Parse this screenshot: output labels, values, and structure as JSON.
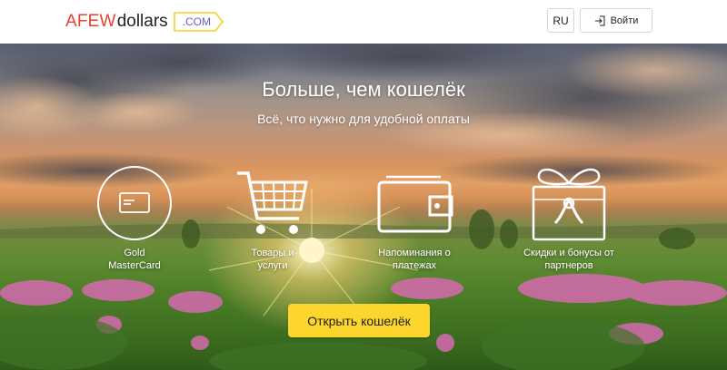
{
  "header": {
    "logo": {
      "part1": "AFEW",
      "part2": "dollars",
      "tld": ".COM"
    },
    "lang_label": "RU",
    "login_label": "Войти"
  },
  "hero": {
    "title": "Больше, чем кошелёк",
    "subtitle": "Всё, что нужно для удобной оплаты",
    "features": [
      {
        "icon": "card-icon",
        "label_line1": "Gold",
        "label_line2": "MasterCard"
      },
      {
        "icon": "shopping-cart-icon",
        "label_line1": "Товары и",
        "label_line2": "услуги"
      },
      {
        "icon": "wallet-icon",
        "label_line1": "Напоминания о",
        "label_line2": "платежах"
      },
      {
        "icon": "gift-icon",
        "label_line1": "Скидки и бонусы от",
        "label_line2": "партнеров"
      }
    ],
    "cta_label": "Открыть кошелёк"
  },
  "colors": {
    "logo_red": "#e8412c",
    "tld_purple": "#6a5bd0",
    "tld_yellow": "#f5d21f",
    "cta_yellow": "#fcd62d"
  }
}
